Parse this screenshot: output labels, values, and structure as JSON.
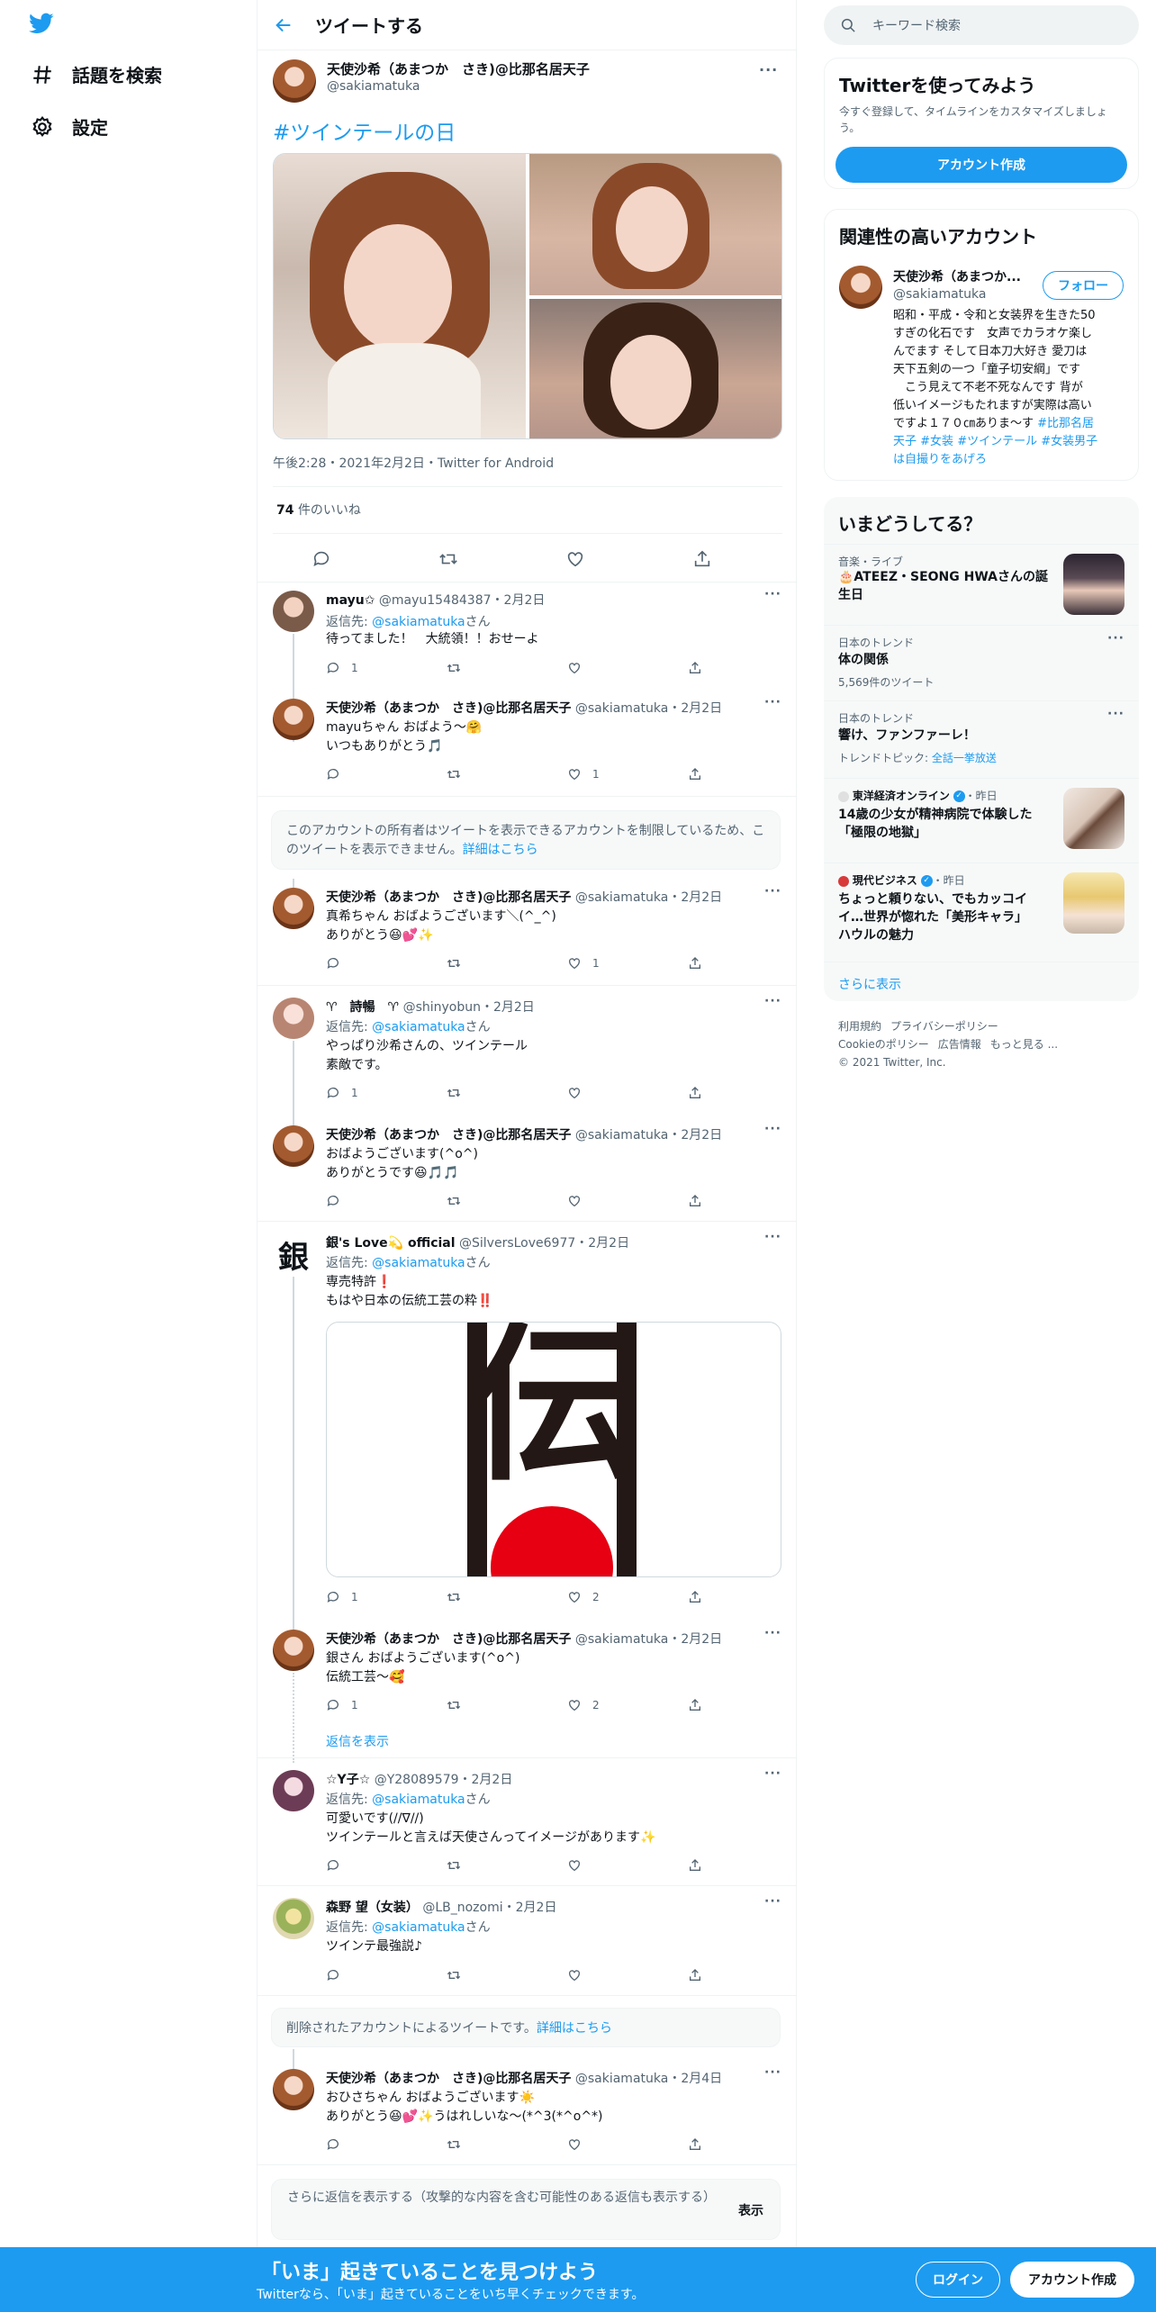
{
  "nav": {
    "explore_label": "話題を検索",
    "settings_label": "設定"
  },
  "header": {
    "title": "ツイートする"
  },
  "main_tweet": {
    "name": "天使沙希（あまつか　さき)@比那名居天子",
    "handle": "@sakiamatuka",
    "hashtag": "#ツインテールの日",
    "meta": "午後2:28・2021年2月2日・Twitter for Android",
    "likes_count": "74",
    "likes_label": "件のいいね"
  },
  "replies": [
    {
      "name": "mayu✩",
      "handle": "@mayu15484387",
      "date": "・2月2日",
      "to_label": "返信先: ",
      "to_link": "@sakiamatuka",
      "to_suffix": "さん",
      "lines": [
        "待ってました！　大統領！！おせーよ"
      ],
      "reply_count": "1",
      "retweet_count": "",
      "like_count": ""
    },
    {
      "name": "天使沙希（あまつか　さき)@比那名居天子",
      "handle": "@sakiamatuka",
      "date": "・2月2日",
      "lines": [
        "mayuちゃん おばよう〜🤗",
        "いつもありがとう🎵"
      ],
      "reply_count": "",
      "retweet_count": "",
      "like_count": "1"
    },
    {
      "notice": "このアカウントの所有者はツイートを表示できるアカウントを制限しているため、このツイートを表示できません。",
      "notice_link": "詳細はこちら"
    },
    {
      "name": "天使沙希（あまつか　さき)@比那名居天子",
      "handle": "@sakiamatuka",
      "date": "・2月2日",
      "lines": [
        "真希ちゃん おばようございます＼(^_^)",
        "ありがとう😆💕✨"
      ],
      "reply_count": "",
      "retweet_count": "",
      "like_count": "1"
    },
    {
      "name": "♈　詩暢　♈",
      "handle": "@shinyobun",
      "date": "・2月2日",
      "to_label": "返信先: ",
      "to_link": "@sakiamatuka",
      "to_suffix": "さん",
      "lines": [
        "やっぱり沙希さんの、ツインテール",
        "素敵です。"
      ],
      "reply_count": "1",
      "retweet_count": "",
      "like_count": ""
    },
    {
      "name": "天使沙希（あまつか　さき)@比那名居天子",
      "handle": "@sakiamatuka",
      "date": "・2月2日",
      "lines": [
        "おばようございます(^o^)",
        "ありがとうです😆🎵🎵"
      ],
      "reply_count": "",
      "retweet_count": "",
      "like_count": ""
    },
    {
      "name": "銀's Love💫 official",
      "handle": "@SilversLove6977",
      "date": "・2月2日",
      "to_label": "返信先: ",
      "to_link": "@sakiamatuka",
      "to_suffix": "さん",
      "lines": [
        "専売特許❗",
        "もはや日本の伝統工芸の粋‼️"
      ],
      "reply_count": "1",
      "retweet_count": "",
      "like_count": "2",
      "image_text": "伝",
      "avatar_char": "銀"
    },
    {
      "name": "天使沙希（あまつか　さき)@比那名居天子",
      "handle": "@sakiamatuka",
      "date": "・2月2日",
      "lines": [
        "銀さん おばようございます(^o^)",
        "伝統工芸〜🥰"
      ],
      "reply_count": "1",
      "retweet_count": "",
      "like_count": "2",
      "show_replies": "返信を表示"
    },
    {
      "name": "☆Y子☆",
      "handle": "@Y28089579",
      "date": "・2月2日",
      "to_label": "返信先: ",
      "to_link": "@sakiamatuka",
      "to_suffix": "さん",
      "lines": [
        "可愛いです(//∇//)",
        "ツインテールと言えば天使さんってイメージがあります✨"
      ],
      "reply_count": "",
      "retweet_count": "",
      "like_count": ""
    },
    {
      "name": "森野 望（女装）",
      "handle": "@LB_nozomi",
      "date": "・2月2日",
      "to_label": "返信先: ",
      "to_link": "@sakiamatuka",
      "to_suffix": "さん",
      "lines": [
        "ツインテ最強説♪"
      ],
      "reply_count": "",
      "retweet_count": "",
      "like_count": ""
    },
    {
      "notice": "削除されたアカウントによるツイートです。",
      "notice_link": "詳細はこちら"
    },
    {
      "name": "天使沙希（あまつか　さき)@比那名居天子",
      "handle": "@sakiamatuka",
      "date": "・2月4日",
      "lines": [
        "おひさちゃん おばようございます☀️",
        "ありがとう😆💕✨うはれしいな〜(*^3(*^o^*)"
      ],
      "reply_count": "",
      "retweet_count": "",
      "like_count": ""
    }
  ],
  "more_replies": {
    "text": "さらに返信を表示する（攻撃的な内容を含む可能性のある返信も表示する）",
    "button": "表示"
  },
  "search": {
    "placeholder": "キーワード検索"
  },
  "signup_card": {
    "title": "Twitterを使ってみよう",
    "desc": "今すぐ登録して、タイムラインをカスタマイズしましょう。",
    "button": "アカウント作成"
  },
  "related": {
    "title": "関連性の高いアカウント",
    "name": "天使沙希（あまつか...",
    "handle": "@sakiamatuka",
    "follow": "フォロー",
    "bio_lines": [
      "昭和・平成・令和と女装界を生きた50",
      "すぎの化石です　女声でカラオケ楽し",
      "んでます そして日本刀大好き 愛刀は",
      "天下五剣の一つ「童子切安綱」です",
      "　こう見えて不老不死なんです 背が",
      "低いイメージもたれますが実際は高い",
      "ですよ１７０㎝ありま～す"
    ],
    "bio_tags": [
      "#比那名居",
      "天子",
      "#女装",
      "#ツインテール",
      "#女装男子",
      "は自撮りをあげろ"
    ]
  },
  "trends": {
    "title": "いまどうしてる？",
    "items": [
      {
        "category": "音楽・ライブ",
        "title_lines": [
          "🎂ATEEZ・SEONG HWAさんの誕",
          "生日"
        ]
      },
      {
        "category": "日本のトレンド",
        "title_lines": [
          "体の関係"
        ],
        "sub": "5,569件のツイート"
      },
      {
        "category": "日本のトレンド",
        "title_lines": [
          "響け、ファンファーレ！"
        ],
        "sub_label": "トレンドトピック: ",
        "sub_link": "全話一挙放送"
      },
      {
        "source": "東洋経済オンライン",
        "time": "・昨日",
        "title_lines": [
          "14歳の少女が精神病院で体験した",
          "「極限の地獄」"
        ]
      },
      {
        "source": "現代ビジネス",
        "time": "・昨日",
        "title_lines": [
          "ちょっと頼りない、でもカッコイ",
          "イ…世界が惚れた「美形キャラ」",
          "ハウルの魅力"
        ]
      }
    ],
    "show_more": "さらに表示"
  },
  "footer": {
    "links": [
      "利用規約",
      "プライバシーポリシー",
      "Cookieのポリシー",
      "広告情報",
      "もっと見る ..."
    ],
    "copyright": "© 2021 Twitter, Inc."
  },
  "bottom_bar": {
    "headline": "「いま」起きていることを見つけよう",
    "sub": "Twitterなら、「いま」起きていることをいち早くチェックできます。",
    "login": "ログイン",
    "signup": "アカウント作成"
  },
  "colors": {
    "accent": "#1d9bf0",
    "text": "#0f1419",
    "muted": "#536471",
    "border": "#eff3f4"
  }
}
